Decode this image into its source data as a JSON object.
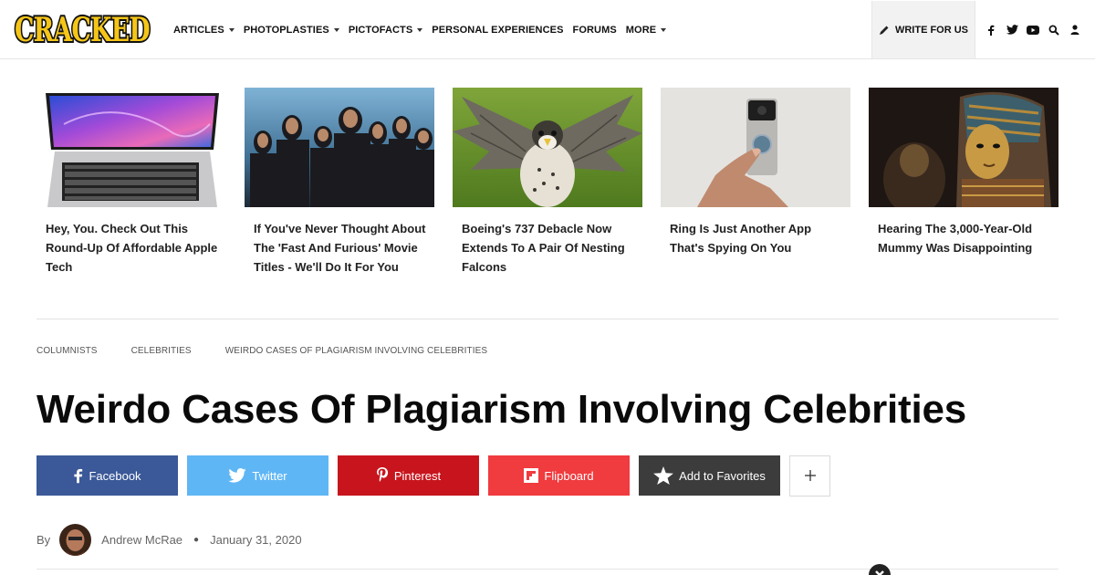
{
  "header": {
    "logo_text": "CRACKED",
    "nav": [
      {
        "label": "ARTICLES",
        "has_menu": true
      },
      {
        "label": "PHOTOPLASTIES",
        "has_menu": true
      },
      {
        "label": "PICTOFACTS",
        "has_menu": true
      },
      {
        "label": "PERSONAL EXPERIENCES",
        "has_menu": false
      },
      {
        "label": "FORUMS",
        "has_menu": false
      },
      {
        "label": "MORE",
        "has_menu": true
      }
    ],
    "write_label": "WRITE FOR US",
    "social_icons": [
      "facebook-icon",
      "twitter-icon",
      "youtube-icon",
      "search-icon",
      "user-icon"
    ]
  },
  "cards": [
    {
      "title": "Hey, You. Check Out This Round-Up Of Affordable Apple Tech",
      "image": "laptop"
    },
    {
      "title": "If You've Never Thought About The 'Fast And Furious' Movie Titles - We'll Do It For You",
      "image": "movie-cast"
    },
    {
      "title": "Boeing's 737 Debacle Now Extends To A Pair Of Nesting Falcons",
      "image": "falcon"
    },
    {
      "title": "Ring Is Just Another App That's Spying On You",
      "image": "doorbell"
    },
    {
      "title": "Hearing The 3,000-Year-Old Mummy Was Disappointing",
      "image": "mummy"
    }
  ],
  "breadcrumb": [
    "COLUMNISTS",
    "CELEBRITIES",
    "WEIRDO CASES OF PLAGIARISM INVOLVING CELEBRITIES"
  ],
  "article": {
    "title": "Weirdo Cases Of Plagiarism Involving Celebrities",
    "by_label": "By",
    "author": "Andrew McRae",
    "date": "January 31, 2020"
  },
  "share": {
    "facebook": "Facebook",
    "twitter": "Twitter",
    "pinterest": "Pinterest",
    "flipboard": "Flipboard",
    "favorites": "Add to Favorites"
  },
  "colors": {
    "facebook": "#3b5998",
    "twitter": "#5fb6f5",
    "pinterest": "#c8151d",
    "flipboard": "#f03b3f",
    "favorites": "#3c3c3c",
    "logo_yellow": "#f5c518"
  }
}
